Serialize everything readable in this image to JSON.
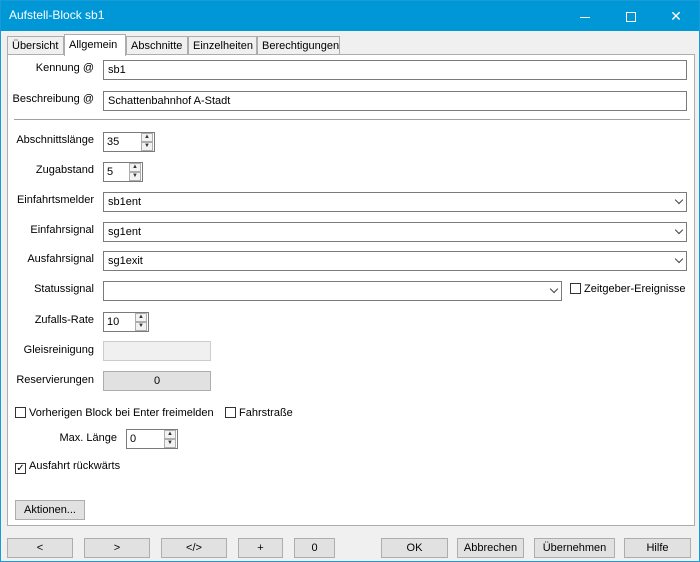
{
  "window": {
    "title": "Aufstell-Block sb1"
  },
  "tabs": [
    "Übersicht",
    "Allgemein",
    "Abschnitte",
    "Einzelheiten",
    "Berechtigungen"
  ],
  "form": {
    "kennung": {
      "label": "Kennung @",
      "value": "sb1"
    },
    "beschreibung": {
      "label": "Beschreibung @",
      "value": "Schattenbahnhof A-Stadt"
    },
    "abschnittslaenge": {
      "label": "Abschnittslänge",
      "value": "35"
    },
    "zugabstand": {
      "label": "Zugabstand",
      "value": "5"
    },
    "einfahrtsmelder": {
      "label": "Einfahrtsmelder",
      "value": "sb1ent"
    },
    "einfahrsignal": {
      "label": "Einfahrsignal",
      "value": "sg1ent"
    },
    "ausfahrsignal": {
      "label": "Ausfahrsignal",
      "value": "sg1exit"
    },
    "statussignal": {
      "label": "Statussignal",
      "value": ""
    },
    "zeitgeber": {
      "label": "Zeitgeber-Ereignisse",
      "checked": false
    },
    "zufallsrate": {
      "label": "Zufalls-Rate",
      "value": "10"
    },
    "gleisreinigung": {
      "label": "Gleisreinigung",
      "value": ""
    },
    "reservierungen": {
      "label": "Reservierungen",
      "value": "0"
    },
    "vorherigen": {
      "label": "Vorherigen Block bei Enter freimelden",
      "checked": false
    },
    "fahrstrasse": {
      "label": "Fahrstraße",
      "checked": false
    },
    "maxlaenge": {
      "label": "Max. Länge",
      "value": "0"
    },
    "ausfahrt_rueckwaerts": {
      "label": "Ausfahrt rückwärts",
      "checked": true
    },
    "aktionen": "Aktionen..."
  },
  "bottom": {
    "prev": "<",
    "next": ">",
    "code": "</>",
    "plus": "+",
    "zero": "0",
    "ok": "OK",
    "cancel": "Abbrechen",
    "apply": "Übernehmen",
    "help": "Hilfe"
  }
}
